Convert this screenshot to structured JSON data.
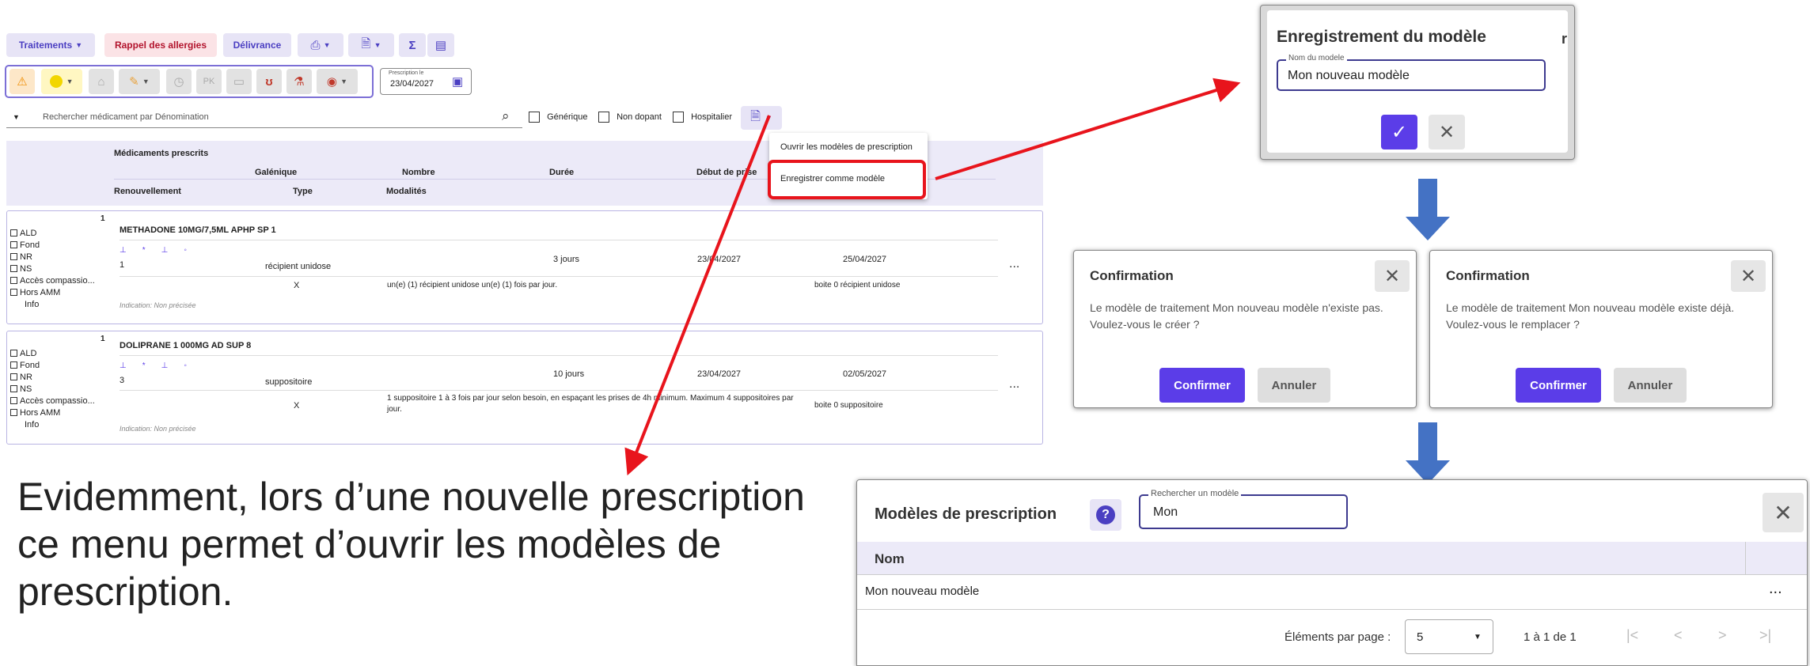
{
  "toolbar": {
    "traitements": "Traitements",
    "rappel": "Rappel des allergies",
    "delivrance": "Délivrance",
    "presc_label": "Prescription le",
    "presc_date": "23/04/2027"
  },
  "search": {
    "placeholder": "Rechercher médicament par Dénomination",
    "generique": "Générique",
    "non_dopant": "Non dopant",
    "hospitalier": "Hospitalier"
  },
  "dropdown": {
    "item1": "Ouvrir les modèles de prescription",
    "item2": "Enregistrer comme modèle"
  },
  "table_header": {
    "medicaments": "Médicaments prescrits",
    "galenique": "Galénique",
    "nombre": "Nombre",
    "duree": "Durée",
    "debut": "Début de prise",
    "renouvellement": "Renouvellement",
    "type": "Type",
    "modalites": "Modalités"
  },
  "checkbox_labels": [
    "ALD",
    "Fond",
    "NR",
    "NS",
    "Accès compassio...",
    "Hors AMM"
  ],
  "info": "Info",
  "indication": "Indication: Non précisée",
  "rows": [
    {
      "num": "1",
      "name": "METHADONE 10MG/7,5ML APHP SP 1",
      "count": "1",
      "galenique": "récipient unidose",
      "duree": "3 jours",
      "debut": "23/04/2027",
      "fin": "25/04/2027",
      "type": "X",
      "modalites": "un(e) (1) récipient unidose  un(e) (1) fois par jour.",
      "boite": "boite 0 récipient unidose"
    },
    {
      "num": "1",
      "name": "DOLIPRANE 1 000MG AD SUP 8",
      "count": "3",
      "galenique": "suppositoire",
      "duree": "10 jours",
      "debut": "23/04/2027",
      "fin": "02/05/2027",
      "type": "X",
      "modalites": "1 suppositoire 1 à 3 fois par jour selon besoin, en espaçant les prises de 4h minimum. Maximum 4 suppositoires par jour.",
      "boite": "boite 0 suppositoire"
    }
  ],
  "more": "...",
  "caption": "Evidemment, lors d’une nouvelle prescription ce menu permet d’ouvrir les modèles de prescription.",
  "save_dialog": {
    "title": "Enregistrement du modèle",
    "field_label": "Nom du modele",
    "field_value": "Mon nouveau modèle",
    "cut_letter": "r"
  },
  "confirm1": {
    "title": "Confirmation",
    "text": "Le modèle de traitement Mon nouveau modèle n'existe pas.\nVoulez-vous le créer ?",
    "ok": "Confirmer",
    "cancel": "Annuler"
  },
  "confirm2": {
    "title": "Confirmation",
    "text": "Le modèle de traitement Mon nouveau modèle existe déjà.\nVoulez-vous le remplacer ?",
    "ok": "Confirmer",
    "cancel": "Annuler"
  },
  "models_dialog": {
    "title": "Modèles de prescription",
    "search_label": "Rechercher un modèle",
    "search_value": "Mon",
    "col_nom": "Nom",
    "row": "Mon nouveau modèle",
    "per_page_label": "Éléments par page :",
    "per_page": "5",
    "range": "1 à 1 de 1"
  },
  "colors": {
    "accent": "#5b3de8",
    "arrow_red": "#e8141c",
    "flow_blue": "#4472c4"
  }
}
